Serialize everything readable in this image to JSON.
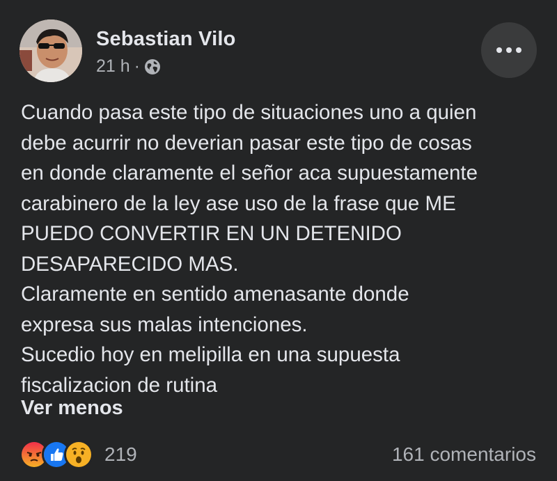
{
  "post": {
    "author": "Sebastian Vilo",
    "timestamp": "21 h",
    "separator": "·",
    "privacy_icon": "globe-icon",
    "body_lines": [
      "Cuando pasa este tipo de situaciones uno a quien",
      "debe acurrir no deverian pasar este tipo de cosas",
      "en donde claramente el señor aca supuestamente",
      "carabinero de la ley ase uso de la frase que ME",
      "PUEDO CONVERTIR EN UN DETENIDO",
      "DESAPARECIDO MAS.",
      "Claramente en sentido amenasante donde",
      "expresa sus malas intenciones.",
      "Sucedio hoy en melipilla en una supuesta",
      "fiscalizacion de rutina"
    ],
    "see_less_label": "Ver menos"
  },
  "footer": {
    "reaction_icons": [
      "angry-reaction-icon",
      "like-reaction-icon",
      "wow-reaction-icon"
    ],
    "reaction_count": "219",
    "comments_label": "161 comentarios"
  },
  "colors": {
    "background": "#242526",
    "primary_text": "#e4e6eb",
    "secondary_text": "#b0b3b8",
    "button_bg": "#3a3b3c",
    "like_blue": "#1877f2",
    "angry_red": "#e9710f",
    "wow_yellow": "#f7b125"
  }
}
